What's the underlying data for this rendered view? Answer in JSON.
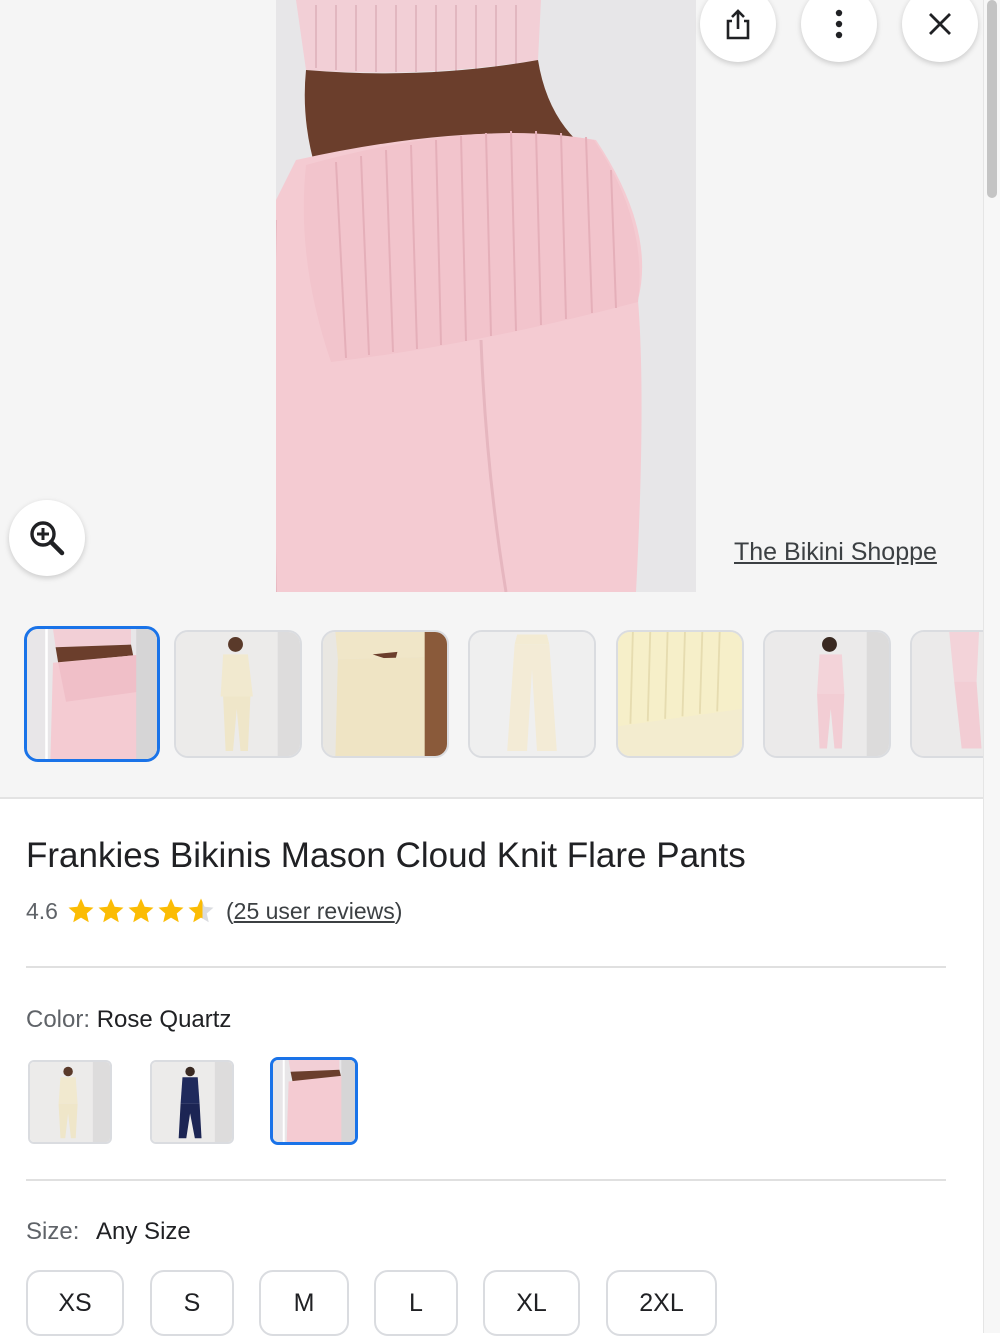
{
  "toolbar": {
    "share_icon": "share-icon",
    "more_icon": "more-vert-icon",
    "close_icon": "close-icon",
    "zoom_icon": "zoom-in-icon"
  },
  "source": {
    "label": "The Bikini Shoppe"
  },
  "product": {
    "title": "Frankies Bikinis Mason Cloud Knit Flare Pants",
    "rating": "4.6",
    "stars": 4.6,
    "reviews_label": "25 user reviews"
  },
  "color": {
    "label": "Color:",
    "value": "Rose Quartz"
  },
  "size": {
    "label": "Size:",
    "value": "Any Size",
    "options": [
      "XS",
      "S",
      "M",
      "L",
      "XL",
      "2XL"
    ]
  },
  "colors": {
    "accent": "#1a73e8",
    "star": "#fbbc04",
    "pink": "#f4cdd3",
    "cream": "#f1e9cf",
    "navy": "#1f2a5c"
  }
}
